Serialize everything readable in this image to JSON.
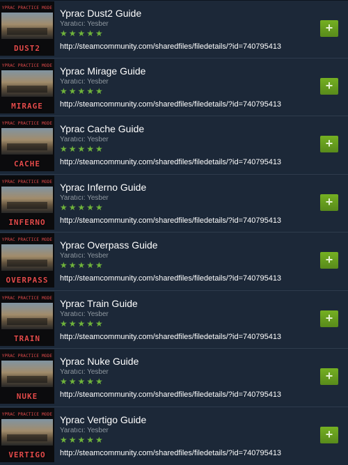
{
  "items": [
    {
      "title": "Yprac Dust2 Guide",
      "creator": "Yaratıcı: Yesber",
      "rating_stars": 5,
      "stars_text": "★★★★★",
      "url": "http://steamcommunity.com/sharedfiles/filedetails/?id=740795413",
      "thumb_tag": "YPRAC PRACTICE MODE",
      "thumb_map": "DUST2",
      "add_label": "+"
    },
    {
      "title": "Yprac Mirage Guide",
      "creator": "Yaratıcı: Yesber",
      "rating_stars": 5,
      "stars_text": "★★★★★",
      "url": "http://steamcommunity.com/sharedfiles/filedetails/?id=740795413",
      "thumb_tag": "YPRAC PRACTICE MODE",
      "thumb_map": "MIRAGE",
      "add_label": "+"
    },
    {
      "title": "Yprac Cache Guide",
      "creator": "Yaratıcı: Yesber",
      "rating_stars": 5,
      "stars_text": "★★★★★",
      "url": "http://steamcommunity.com/sharedfiles/filedetails/?id=740795413",
      "thumb_tag": "YPRAC PRACTICE MODE",
      "thumb_map": "CACHE",
      "add_label": "+"
    },
    {
      "title": "Yprac Inferno Guide",
      "creator": "Yaratıcı: Yesber",
      "rating_stars": 5,
      "stars_text": "★★★★★",
      "url": "http://steamcommunity.com/sharedfiles/filedetails/?id=740795413",
      "thumb_tag": "YPRAC PRACTICE MODE",
      "thumb_map": "INFERNO",
      "add_label": "+"
    },
    {
      "title": "Yprac Overpass Guide",
      "creator": "Yaratıcı: Yesber",
      "rating_stars": 5,
      "stars_text": "★★★★★",
      "url": "http://steamcommunity.com/sharedfiles/filedetails/?id=740795413",
      "thumb_tag": "YPRAC PRACTICE MODE",
      "thumb_map": "OVERPASS",
      "add_label": "+"
    },
    {
      "title": "Yprac Train Guide",
      "creator": "Yaratıcı: Yesber",
      "rating_stars": 5,
      "stars_text": "★★★★★",
      "url": "http://steamcommunity.com/sharedfiles/filedetails/?id=740795413",
      "thumb_tag": "YPRAC PRACTICE MODE",
      "thumb_map": "TRAIN",
      "add_label": "+"
    },
    {
      "title": "Yprac Nuke Guide",
      "creator": "Yaratıcı: Yesber",
      "rating_stars": 5,
      "stars_text": "★★★★★",
      "url": "http://steamcommunity.com/sharedfiles/filedetails/?id=740795413",
      "thumb_tag": "YPRAC PRACTICE MODE",
      "thumb_map": "NUKE",
      "add_label": "+"
    },
    {
      "title": "Yprac Vertigo Guide",
      "creator": "Yaratıcı: Yesber",
      "rating_stars": 5,
      "stars_text": "★★★★★",
      "url": "http://steamcommunity.com/sharedfiles/filedetails/?id=740795413",
      "thumb_tag": "YPRAC PRACTICE MODE",
      "thumb_map": "VERTIGO",
      "add_label": "+"
    }
  ],
  "colors": {
    "background": "#1b2838",
    "accent_green": "#75b022",
    "star_green": "#6fb33b",
    "thumb_text_red": "#e34b4b"
  },
  "icons": {
    "add": "plus-icon",
    "rating": "star-icon"
  }
}
